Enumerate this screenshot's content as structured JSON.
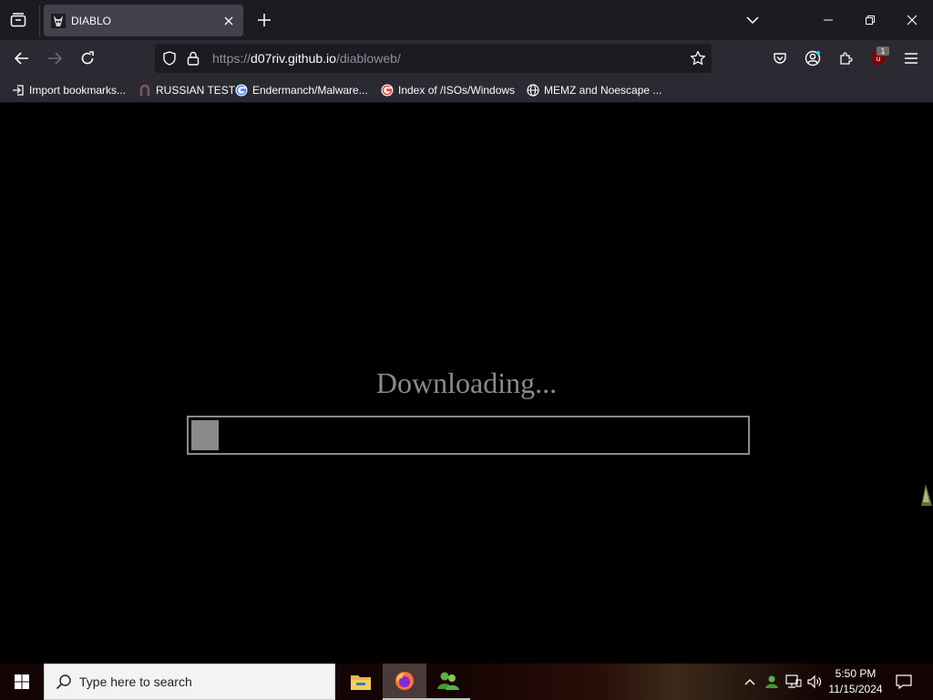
{
  "browser": {
    "tab": {
      "title": "DIABLO"
    },
    "url": {
      "scheme": "https://",
      "host": "d07riv.github.io",
      "path": "/diabloweb/"
    },
    "extension_badge": "1",
    "bookmarks": [
      {
        "label": "Import bookmarks...",
        "icon": "import-icon"
      },
      {
        "label": "RUSSIAN TEST",
        "icon": "horseshoe-icon"
      },
      {
        "label": "Endermanch/Malware...",
        "icon": "google-icon"
      },
      {
        "label": "Index of /ISOs/Windows",
        "icon": "google-icon"
      },
      {
        "label": "MEMZ and Noescape ...",
        "icon": "globe-icon"
      }
    ]
  },
  "content": {
    "loading_text": "Downloading...",
    "progress_fraction": 0.05
  },
  "taskbar": {
    "search_placeholder": "Type here to search",
    "time": "5:50 PM",
    "date": "11/15/2024"
  },
  "colors": {
    "tabstrip": "#1c1b22",
    "toolbar": "#2b2a33",
    "loading_gray": "#8a8a8a",
    "page_bg": "#000000"
  }
}
